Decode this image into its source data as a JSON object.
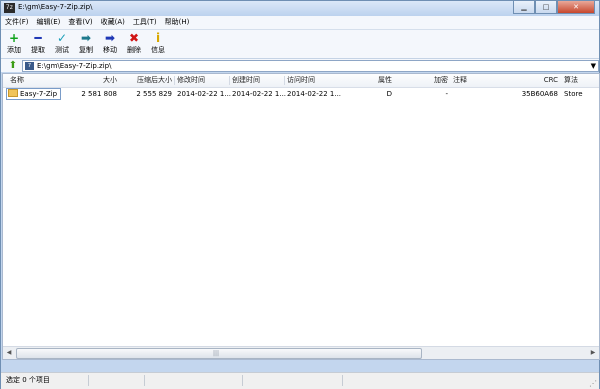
{
  "window": {
    "title": "E:\\gm\\Easy-7-Zip.zip\\",
    "app_icon": "7z"
  },
  "menu": [
    "文件(F)",
    "编辑(E)",
    "查看(V)",
    "收藏(A)",
    "工具(T)",
    "帮助(H)"
  ],
  "toolbar": [
    {
      "label": "添加",
      "icon": "add-icon",
      "glyph": "+"
    },
    {
      "label": "提取",
      "icon": "extract-icon",
      "glyph": "━"
    },
    {
      "label": "测试",
      "icon": "test-icon",
      "glyph": "✓"
    },
    {
      "label": "复制",
      "icon": "copy-icon",
      "glyph": "➡"
    },
    {
      "label": "移动",
      "icon": "move-icon",
      "glyph": "➡"
    },
    {
      "label": "删除",
      "icon": "delete-icon",
      "glyph": "✖"
    },
    {
      "label": "信息",
      "icon": "info-icon",
      "glyph": "i"
    }
  ],
  "address": {
    "path": "E:\\gm\\Easy-7-Zip.zip\\"
  },
  "columns": {
    "name": "名称",
    "size": "大小",
    "packed": "压缩后大小",
    "modified": "修改时间",
    "created": "创建时间",
    "accessed": "访问时间",
    "attributes": "属性",
    "encrypted": "加密",
    "comment": "注释",
    "crc": "CRC",
    "method": "算法"
  },
  "rows": [
    {
      "name": "Easy-7-Zip",
      "size": "2 581 808",
      "packed": "2 555 829",
      "modified": "2014-02-22 1...",
      "created": "2014-02-22 1...",
      "accessed": "2014-02-22 1...",
      "attributes": "D",
      "encrypted": "-",
      "comment": "",
      "crc": "35B60A68",
      "method": "Store"
    }
  ],
  "status": {
    "selected": "选定 0 个项目"
  },
  "colors": {
    "title_bg": "#c3d6ee",
    "close_btn": "#c7472e",
    "folder": "#f1c45a"
  }
}
